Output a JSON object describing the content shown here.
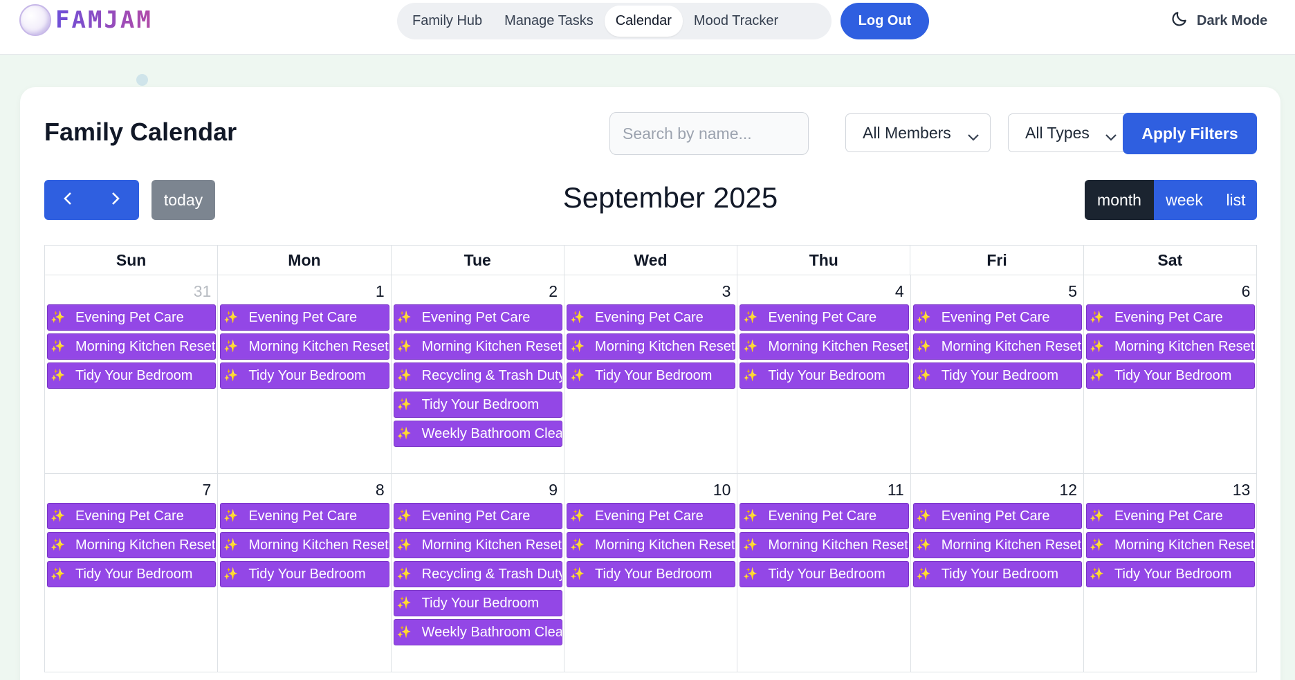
{
  "app": {
    "name": "FAMJAM"
  },
  "nav": {
    "items": [
      {
        "label": "Family Hub",
        "active": false
      },
      {
        "label": "Manage Tasks",
        "active": false
      },
      {
        "label": "Calendar",
        "active": true
      },
      {
        "label": "Mood Tracker",
        "active": false
      }
    ],
    "logout_label": "Log Out",
    "dark_mode_label": "Dark Mode",
    "dark_mode_icon": "moon-icon"
  },
  "calendar": {
    "title": "Family Calendar",
    "search_placeholder": "Search by name...",
    "members_filter": "All Members",
    "types_filter": "All Types",
    "apply_label": "Apply Filters",
    "prev_icon": "chevron-left-icon",
    "next_icon": "chevron-right-icon",
    "today_label": "today",
    "month_title": "September 2025",
    "views": [
      {
        "label": "month",
        "active": true
      },
      {
        "label": "week",
        "active": false
      },
      {
        "label": "list",
        "active": false
      }
    ],
    "weekdays": [
      "Sun",
      "Mon",
      "Tue",
      "Wed",
      "Thu",
      "Fri",
      "Sat"
    ],
    "event_icon": "✨",
    "weeks": [
      [
        {
          "num": "31",
          "other_month": true,
          "events": [
            "Evening Pet Care",
            "Morning Kitchen Reset",
            "Tidy Your Bedroom"
          ]
        },
        {
          "num": "1",
          "events": [
            "Evening Pet Care",
            "Morning Kitchen Reset",
            "Tidy Your Bedroom"
          ]
        },
        {
          "num": "2",
          "events": [
            "Evening Pet Care",
            "Morning Kitchen Reset",
            "Recycling & Trash Duty",
            "Tidy Your Bedroom",
            "Weekly Bathroom Clean"
          ]
        },
        {
          "num": "3",
          "events": [
            "Evening Pet Care",
            "Morning Kitchen Reset",
            "Tidy Your Bedroom"
          ]
        },
        {
          "num": "4",
          "events": [
            "Evening Pet Care",
            "Morning Kitchen Reset",
            "Tidy Your Bedroom"
          ]
        },
        {
          "num": "5",
          "events": [
            "Evening Pet Care",
            "Morning Kitchen Reset",
            "Tidy Your Bedroom"
          ]
        },
        {
          "num": "6",
          "events": [
            "Evening Pet Care",
            "Morning Kitchen Reset",
            "Tidy Your Bedroom"
          ]
        }
      ],
      [
        {
          "num": "7",
          "events": [
            "Evening Pet Care",
            "Morning Kitchen Reset",
            "Tidy Your Bedroom"
          ]
        },
        {
          "num": "8",
          "events": [
            "Evening Pet Care",
            "Morning Kitchen Reset",
            "Tidy Your Bedroom"
          ]
        },
        {
          "num": "9",
          "events": [
            "Evening Pet Care",
            "Morning Kitchen Reset",
            "Recycling & Trash Duty",
            "Tidy Your Bedroom",
            "Weekly Bathroom Clean"
          ]
        },
        {
          "num": "10",
          "events": [
            "Evening Pet Care",
            "Morning Kitchen Reset",
            "Tidy Your Bedroom"
          ]
        },
        {
          "num": "11",
          "events": [
            "Evening Pet Care",
            "Morning Kitchen Reset",
            "Tidy Your Bedroom"
          ]
        },
        {
          "num": "12",
          "events": [
            "Evening Pet Care",
            "Morning Kitchen Reset",
            "Tidy Your Bedroom"
          ]
        },
        {
          "num": "13",
          "events": [
            "Evening Pet Care",
            "Morning Kitchen Reset",
            "Tidy Your Bedroom"
          ]
        }
      ]
    ]
  },
  "colors": {
    "primary": "#2f5fe0",
    "event": "#9347e6",
    "active_view": "#1b2430",
    "today_button": "#7c8590",
    "page_bg": "#eef7f1"
  }
}
